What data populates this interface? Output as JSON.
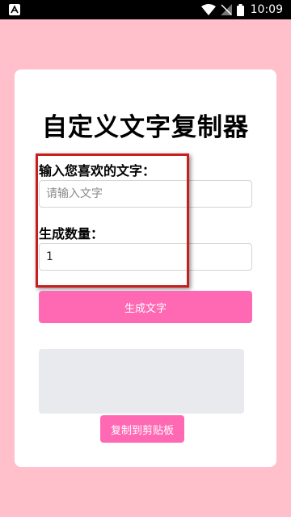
{
  "status_bar": {
    "time": "10:09",
    "icons": [
      "app-notification-icon",
      "wifi-icon",
      "no-signal-icon",
      "battery-icon"
    ]
  },
  "app": {
    "title": "自定义文字复制器",
    "text_label": "输入您喜欢的文字：",
    "text_placeholder": "请输入文字",
    "text_value": "",
    "count_label": "生成数量：",
    "count_value": "1",
    "generate_label": "生成文字",
    "output_text": "",
    "copy_label": "复制到剪贴板"
  },
  "colors": {
    "page_background": "#ffc0cb",
    "button": "#ff69b4",
    "highlight": "#c81e1e",
    "output_background": "#e8eaee"
  }
}
